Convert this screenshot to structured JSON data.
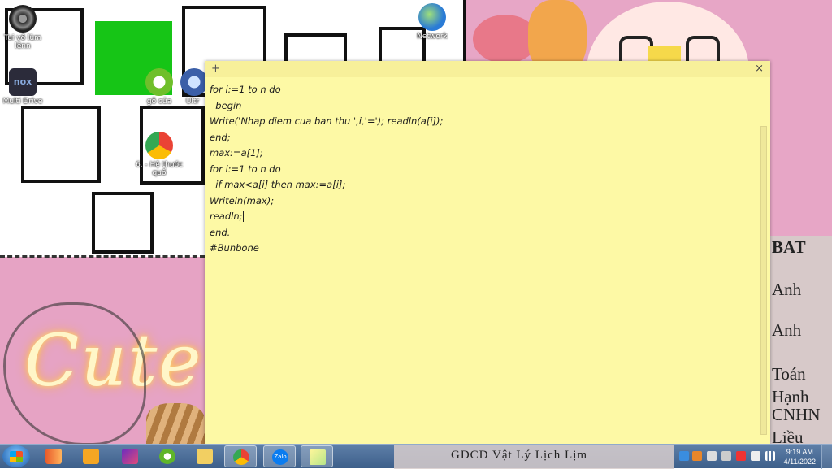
{
  "desktop": {
    "icons": [
      {
        "name": "tui-vo-lum-lenn-icon",
        "label": "Tui vồ lùm lênn"
      },
      {
        "name": "multi-drive-icon",
        "label": "Multi Drive"
      },
      {
        "name": "go-cua-icon",
        "label": "gõ của"
      },
      {
        "name": "ultra-icon",
        "label": "Ultr"
      },
      {
        "name": "chrome-shortcut-icon",
        "label": "6. - Hệ thước quố"
      },
      {
        "name": "network-icon",
        "label": "Network"
      }
    ],
    "wallpaper_text": "Cute",
    "wallpaper_notes": [
      "BAT",
      "Anh",
      "Anh",
      "Toán",
      "Hạnh",
      "CNHN",
      "Liều"
    ]
  },
  "sticky_note": {
    "add_symbol": "+",
    "close_symbol": "×",
    "lines": [
      "for i:=1 to n do",
      "  begin",
      "Write('Nhap diem cua ban thu ',i,'='); readln(a[i]);",
      "end;",
      "max:=a[1];",
      "for i:=1 to n do",
      "  if max<a[i] then max:=a[i];",
      "Writeln(max);",
      "readln;",
      "end.",
      "#Bunbone"
    ]
  },
  "taskbar": {
    "tray_overlay_text": "GDCD  Vật Lý  Lịch  Lịm",
    "clock_time": "9:19 AM",
    "clock_date": "4/11/2022"
  },
  "colors": {
    "note_bg": "#fdf9a5",
    "green_box": "#16c516",
    "wallpaper_pink": "#e7a6c6"
  }
}
